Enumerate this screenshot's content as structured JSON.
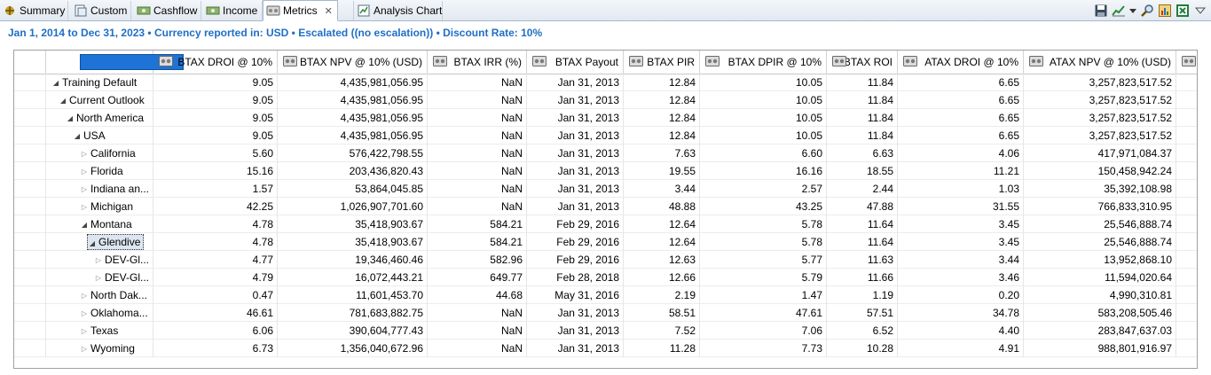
{
  "tabs": [
    {
      "label": "Summary",
      "icon": "summary-icon",
      "active": false
    },
    {
      "label": "Custom",
      "icon": "custom-icon",
      "active": false
    },
    {
      "label": "Cashflow",
      "icon": "cashflow-icon",
      "active": false
    },
    {
      "label": "Income",
      "icon": "income-icon",
      "active": false
    },
    {
      "label": "Metrics",
      "icon": "metrics-icon",
      "active": true,
      "closable": true
    },
    {
      "label": "Analysis Chart",
      "icon": "analysis-chart-icon",
      "active": false
    }
  ],
  "toolbar": {
    "icons": [
      "save-icon",
      "chart-trend-icon",
      "dropdown-arrow-icon",
      "search-icon",
      "report-icon",
      "excel-icon",
      "view-menu-icon"
    ]
  },
  "info": "Jan 1, 2014 to Dec 31, 2023 • Currency reported in: USD • Escalated ((no escalation)) • Discount Rate: 10%",
  "columns": [
    "BTAX DROI @ 10%",
    "BTAX NPV @ 10% (USD)",
    "BTAX IRR (%)",
    "BTAX Payout",
    "BTAX PIR",
    "BTAX DPIR @ 10%",
    "BTAX ROI",
    "ATAX DROI @ 10%",
    "ATAX NPV @ 10% (USD)"
  ],
  "rows": [
    {
      "name": "Training Default",
      "level": 0,
      "expanded": true,
      "values": [
        "9.05",
        "4,435,981,056.95",
        "NaN",
        "Jan 31, 2013",
        "12.84",
        "10.05",
        "11.84",
        "6.65",
        "3,257,823,517.52"
      ]
    },
    {
      "name": "Current Outlook",
      "level": 1,
      "expanded": true,
      "values": [
        "9.05",
        "4,435,981,056.95",
        "NaN",
        "Jan 31, 2013",
        "12.84",
        "10.05",
        "11.84",
        "6.65",
        "3,257,823,517.52"
      ]
    },
    {
      "name": "North America",
      "level": 2,
      "expanded": true,
      "values": [
        "9.05",
        "4,435,981,056.95",
        "NaN",
        "Jan 31, 2013",
        "12.84",
        "10.05",
        "11.84",
        "6.65",
        "3,257,823,517.52"
      ]
    },
    {
      "name": "USA",
      "level": 3,
      "expanded": true,
      "values": [
        "9.05",
        "4,435,981,056.95",
        "NaN",
        "Jan 31, 2013",
        "12.84",
        "10.05",
        "11.84",
        "6.65",
        "3,257,823,517.52"
      ]
    },
    {
      "name": "California",
      "level": 4,
      "expanded": false,
      "values": [
        "5.60",
        "576,422,798.55",
        "NaN",
        "Jan 31, 2013",
        "7.63",
        "6.60",
        "6.63",
        "4.06",
        "417,971,084.37"
      ]
    },
    {
      "name": "Florida",
      "level": 4,
      "expanded": false,
      "values": [
        "15.16",
        "203,436,820.43",
        "NaN",
        "Jan 31, 2013",
        "19.55",
        "16.16",
        "18.55",
        "11.21",
        "150,458,942.24"
      ]
    },
    {
      "name": "Indiana an...",
      "level": 4,
      "expanded": false,
      "values": [
        "1.57",
        "53,864,045.85",
        "NaN",
        "Jan 31, 2013",
        "3.44",
        "2.57",
        "2.44",
        "1.03",
        "35,392,108.98"
      ]
    },
    {
      "name": "Michigan",
      "level": 4,
      "expanded": false,
      "values": [
        "42.25",
        "1,026,907,701.60",
        "NaN",
        "Jan 31, 2013",
        "48.88",
        "43.25",
        "47.88",
        "31.55",
        "766,833,310.95"
      ]
    },
    {
      "name": "Montana",
      "level": 4,
      "expanded": true,
      "values": [
        "4.78",
        "35,418,903.67",
        "584.21",
        "Feb 29, 2016",
        "12.64",
        "5.78",
        "11.64",
        "3.45",
        "25,546,888.74"
      ]
    },
    {
      "name": "Glendive",
      "level": 5,
      "expanded": true,
      "selected": true,
      "values": [
        "4.78",
        "35,418,903.67",
        "584.21",
        "Feb 29, 2016",
        "12.64",
        "5.78",
        "11.64",
        "3.45",
        "25,546,888.74"
      ]
    },
    {
      "name": "DEV-Gl...",
      "level": 6,
      "expanded": false,
      "values": [
        "4.77",
        "19,346,460.46",
        "582.96",
        "Feb 29, 2016",
        "12.63",
        "5.77",
        "11.63",
        "3.44",
        "13,952,868.10"
      ]
    },
    {
      "name": "DEV-Gl...",
      "level": 6,
      "expanded": false,
      "values": [
        "4.79",
        "16,072,443.21",
        "649.77",
        "Feb 28, 2018",
        "12.66",
        "5.79",
        "11.66",
        "3.46",
        "11,594,020.64"
      ]
    },
    {
      "name": "North Dak...",
      "level": 4,
      "expanded": false,
      "values": [
        "0.47",
        "11,601,453.70",
        "44.68",
        "May 31, 2016",
        "2.19",
        "1.47",
        "1.19",
        "0.20",
        "4,990,310.81"
      ]
    },
    {
      "name": "Oklahoma...",
      "level": 4,
      "expanded": false,
      "values": [
        "46.61",
        "781,683,882.75",
        "NaN",
        "Jan 31, 2013",
        "58.51",
        "47.61",
        "57.51",
        "34.78",
        "583,208,505.46"
      ]
    },
    {
      "name": "Texas",
      "level": 4,
      "expanded": false,
      "values": [
        "6.06",
        "390,604,777.43",
        "NaN",
        "Jan 31, 2013",
        "7.52",
        "7.06",
        "6.52",
        "4.40",
        "283,847,637.03"
      ]
    },
    {
      "name": "Wyoming",
      "level": 4,
      "expanded": false,
      "values": [
        "6.73",
        "1,356,040,672.96",
        "NaN",
        "Jan 31, 2013",
        "11.28",
        "7.73",
        "10.28",
        "4.91",
        "988,801,916.97"
      ]
    }
  ],
  "colors": {
    "accent": "#1f6fc6",
    "selected_header": "#1e73d6",
    "excel": "#1e7e3c"
  }
}
